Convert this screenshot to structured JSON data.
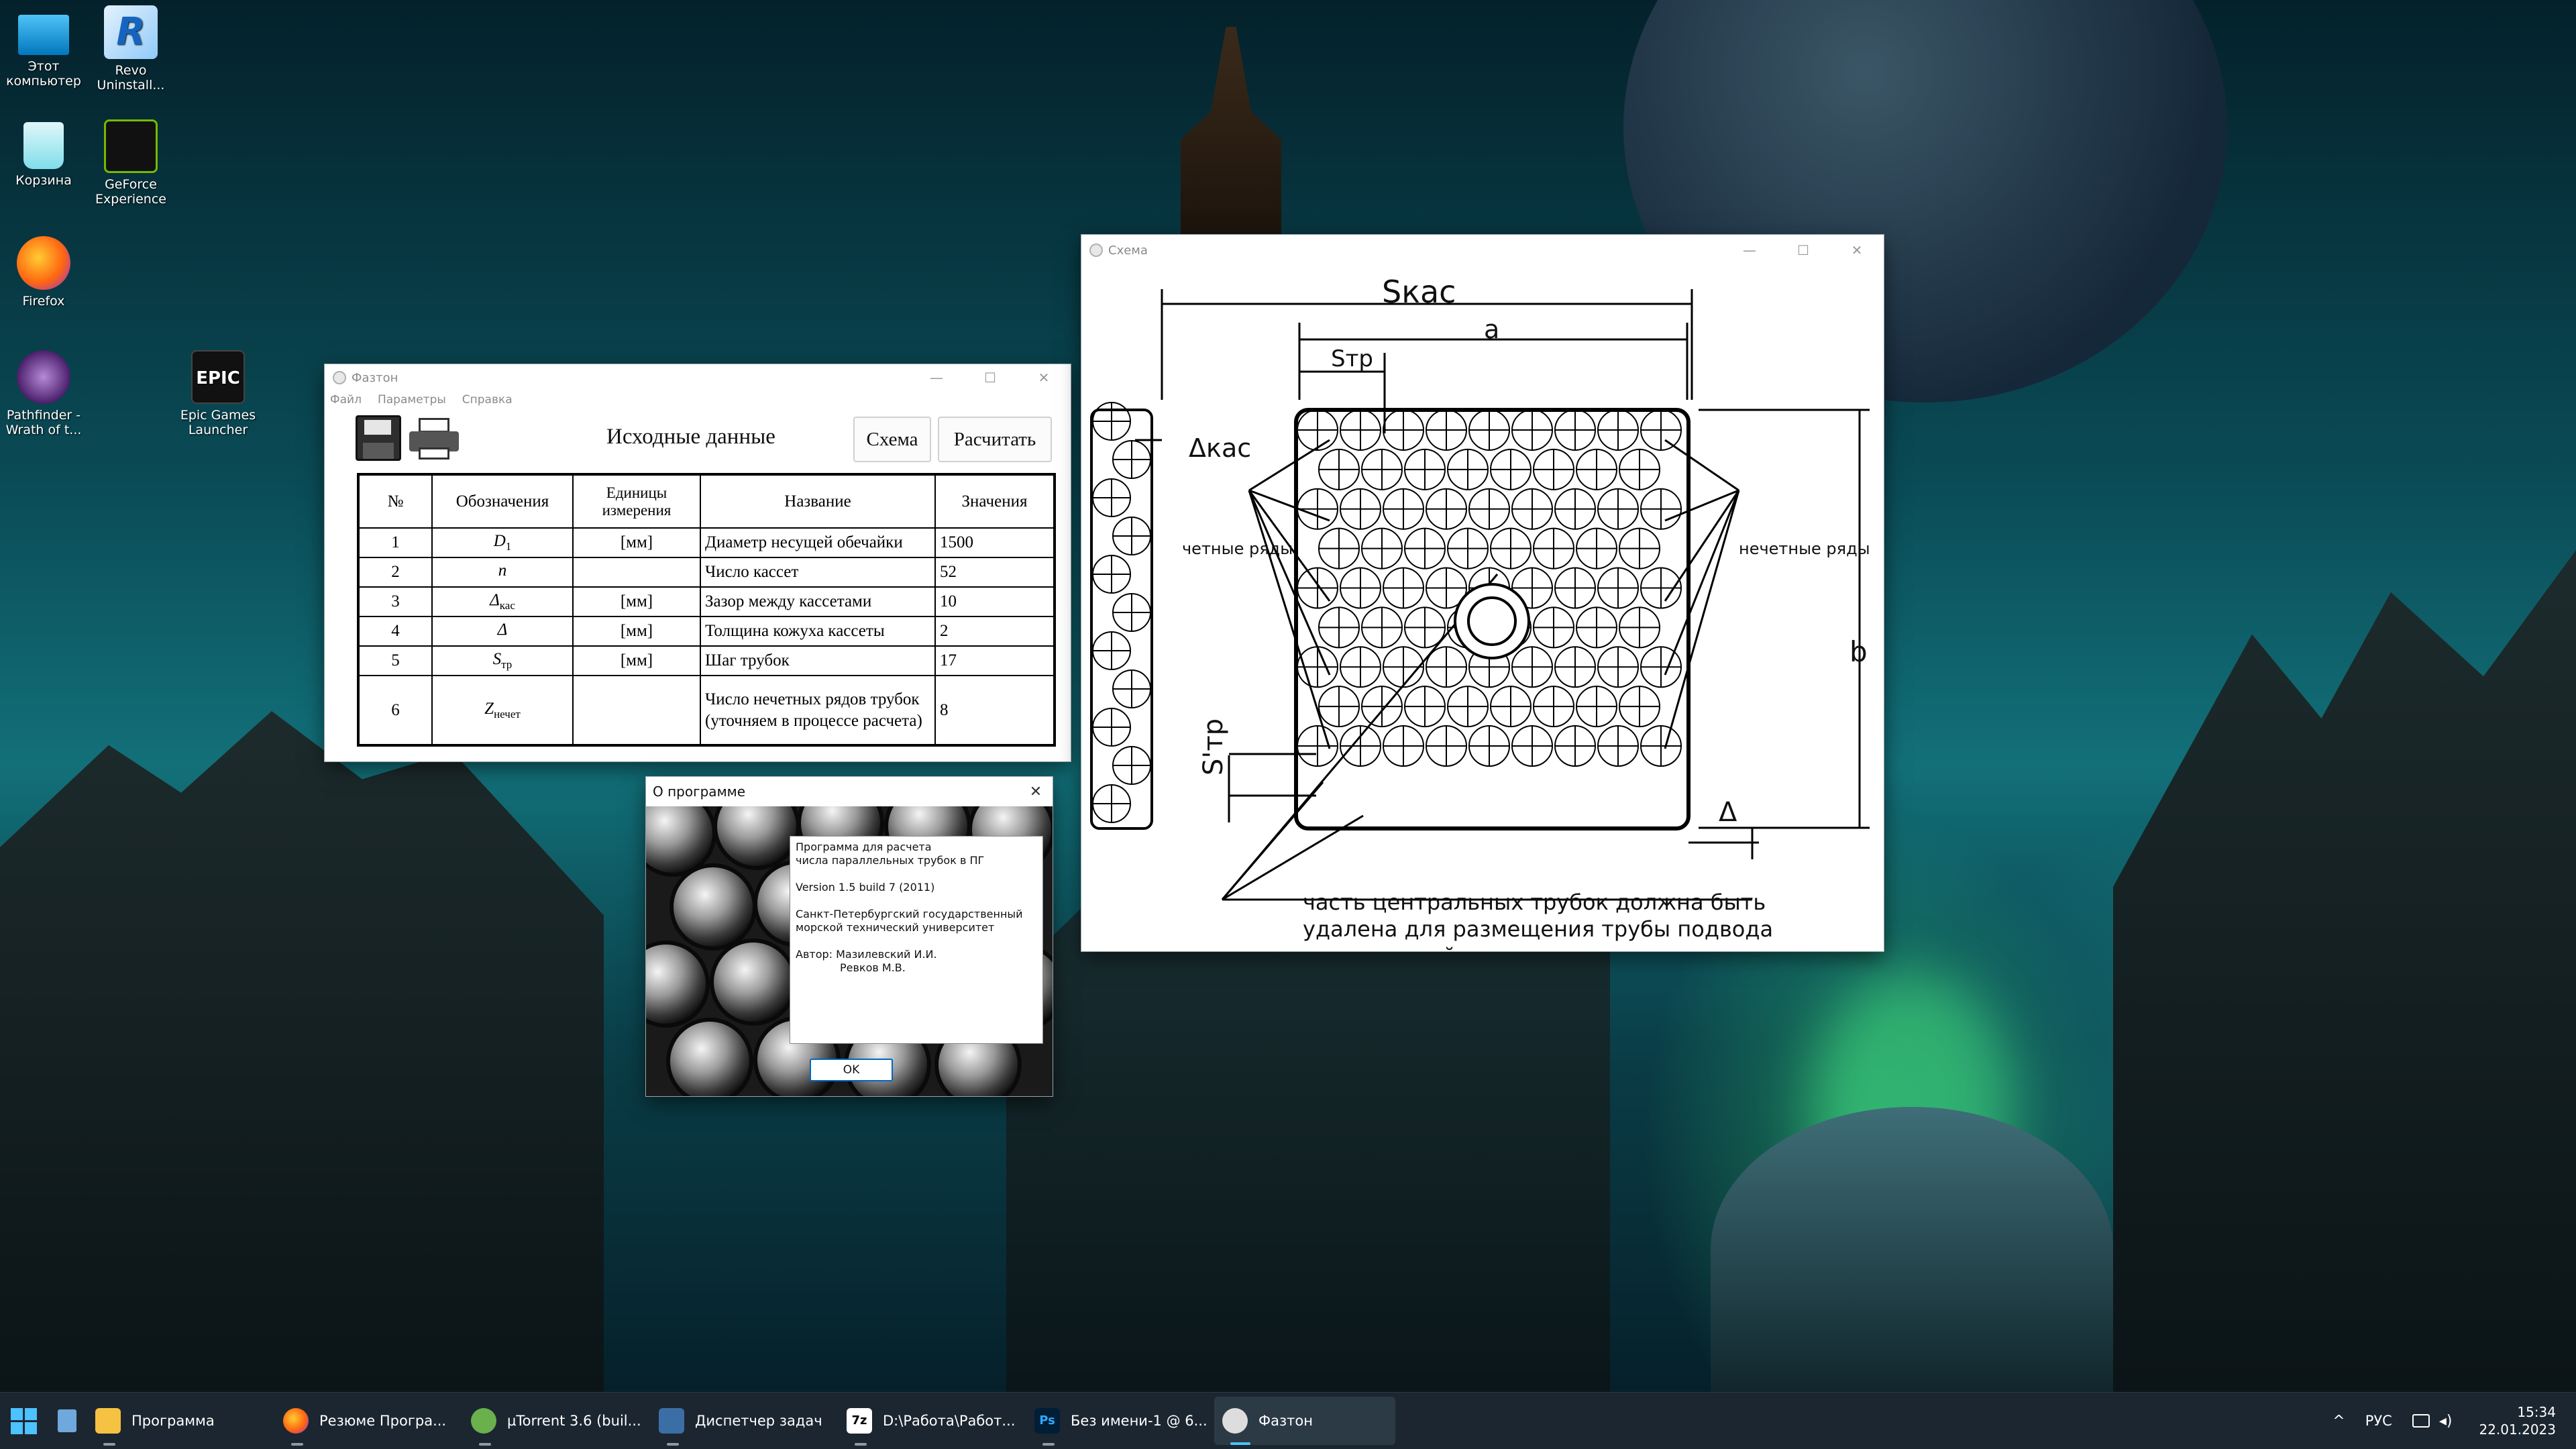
{
  "desktop": {
    "icons": [
      {
        "label": "Этот компьютер",
        "icon": "computer-icon"
      },
      {
        "label": "Revo Uninstall...",
        "icon": "revo-uninstaller-icon"
      },
      {
        "label": "Корзина",
        "icon": "recycle-bin-icon"
      },
      {
        "label": "GeForce Experience",
        "icon": "geforce-icon"
      },
      {
        "label": "Firefox",
        "icon": "firefox-icon"
      },
      {
        "label": "Pathfinder - Wrath of t...",
        "icon": "pathfinder-icon"
      },
      {
        "label": "Epic Games Launcher",
        "icon": "epic-games-icon"
      }
    ]
  },
  "main_window": {
    "title": "Фазтон",
    "menu": [
      "Файл",
      "Параметры",
      "Справка"
    ],
    "heading": "Исходные данные",
    "buttons": {
      "scheme": "Схема",
      "calculate": "Расчитать"
    },
    "table": {
      "headers": [
        "№",
        "Обозначения",
        "Единицы измерения",
        "Название",
        "Значения"
      ],
      "rows": [
        {
          "n": "1",
          "sym": "D",
          "sub": "1",
          "unit": "[мм]",
          "name": "Диаметр несущей обечайки",
          "value": "1500"
        },
        {
          "n": "2",
          "sym": "n",
          "sub": "",
          "unit": "",
          "name": "Число кассет",
          "value": "52"
        },
        {
          "n": "3",
          "sym": "Δ",
          "sub": "кас",
          "unit": "[мм]",
          "name": "Зазор между кассетами",
          "value": "10"
        },
        {
          "n": "4",
          "sym": "Δ",
          "sub": "",
          "unit": "[мм]",
          "name": "Толщина кожуха кассеты",
          "value": "2"
        },
        {
          "n": "5",
          "sym": "S",
          "sub": "тр",
          "unit": "[мм]",
          "name": "Шаг трубок",
          "value": "17"
        },
        {
          "n": "6",
          "sym": "Z",
          "sub": "нечет",
          "unit": "",
          "name": "Число нечетных рядов трубок (уточняем в процессе расчета)",
          "value": "8"
        }
      ]
    }
  },
  "about_dialog": {
    "title": "О программе",
    "lines": [
      "Программа для расчета",
      "числа параллельных трубок в ПГ",
      "Version 1.5  build 7  (2011)",
      "Санкт-Петербургский государственный",
      "морской технический университет",
      "Автор: Мазилевский И.И.",
      "Ревков М.В."
    ],
    "ok": "OK"
  },
  "scheme_window": {
    "title": "Схема",
    "labels": {
      "s_kas": "Sкас",
      "a": "a",
      "s_tr": "Sтр",
      "delta_kas": "Δкас",
      "even_rows": "четные ряды",
      "odd_rows": "нечетные ряды",
      "s_tr_prime": "S'тр",
      "b": "b",
      "delta": "Δ",
      "note1": "часть центральных трубок должна быть",
      "note2": "удалена для размещения трубы подвода",
      "note3": "питательной воды"
    }
  },
  "taskbar": {
    "items": [
      {
        "label": "Программа",
        "icon": "folder-icon"
      },
      {
        "label": "Резюме Програ...",
        "icon": "firefox-icon"
      },
      {
        "label": "µTorrent 3.6  (buil...",
        "icon": "utorrent-icon"
      },
      {
        "label": "Диспетчер задач",
        "icon": "task-manager-icon"
      },
      {
        "label": "D:\\Работа\\Работ...",
        "icon": "7zip-icon"
      },
      {
        "label": "Без имени-1 @ 6...",
        "icon": "photoshop-icon"
      },
      {
        "label": "Фазтон",
        "icon": "faston-app-icon"
      }
    ],
    "lang": "РУС",
    "time": "15:34",
    "date": "22.01.2023"
  }
}
